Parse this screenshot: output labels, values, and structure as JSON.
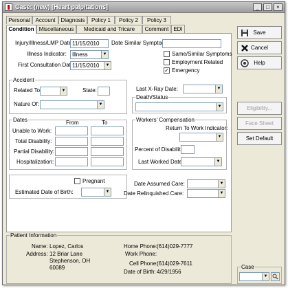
{
  "window": {
    "title": "Case: (new) [Heart palpitations]",
    "minimize": "_",
    "maximize": "□",
    "close": "×"
  },
  "tabs_top": [
    "Personal",
    "Account",
    "Diagnosis",
    "Policy 1",
    "Policy 2",
    "Policy 3"
  ],
  "tabs_bottom": [
    "Condition",
    "Miscellaneous",
    "Medicaid and Tricare",
    "Comment",
    "EDI"
  ],
  "condition": {
    "injury_label": "Injury/Illness/LMP Date:",
    "injury_value": "11/15/2010",
    "similar_symptoms_label": "Date Similar Symptoms:",
    "similar_symptoms_value": "",
    "illness_indicator_label": "Illness Indicator:",
    "illness_indicator_value": "Illness",
    "first_consult_label": "First Consultation Date:",
    "first_consult_value": "11/15/2010",
    "same_similar_label": "Same/Similar Symptoms",
    "employment_label": "Employment Related",
    "emergency_label": "Emergency",
    "same_similar_checked": false,
    "employment_checked": false,
    "emergency_checked": true
  },
  "accident": {
    "title": "Accident",
    "related_to_label": "Related To:",
    "state_label": "State:",
    "nature_of_label": "Nature Of:"
  },
  "xray": {
    "label": "Last X-Ray Date:",
    "death_status_title": "Death/Status"
  },
  "dates": {
    "title": "Dates",
    "from_label": "From",
    "to_label": "To",
    "rows": [
      "Unable to Work:",
      "Total Disability:",
      "Partial Disability:",
      "Hospitalization:"
    ]
  },
  "workers_comp": {
    "title": "Workers' Compensation",
    "return_label": "Return To Work Indicator:",
    "percent_label": "Percent of Disability:",
    "last_worked_label": "Last Worked Date:"
  },
  "pregnancy": {
    "pregnant_label": "Pregnant",
    "pregnant_checked": false,
    "edb_label": "Estimated Date of Birth:"
  },
  "care": {
    "assumed_label": "Date Assumed Care:",
    "relinquished_label": "Date Relinquished Care:"
  },
  "buttons": {
    "save": "Save",
    "cancel": "Cancel",
    "help": "Help",
    "eligibility": "Eligibility...",
    "face_sheet": "Face Sheet",
    "set_default": "Set Default"
  },
  "patient": {
    "title": "Patient Information",
    "name_label": "Name:",
    "name_value": "Lopez, Carlos",
    "address_label": "Address:",
    "address_line1": "12 Briar Lane",
    "address_line2": "Stephenson, OH",
    "address_line3": "60089",
    "home_phone_label": "Home Phone:",
    "home_phone_value": "(614)029-7777",
    "work_phone_label": "Work Phone:",
    "work_phone_value": "",
    "cell_phone_label": "Cell Phone:",
    "cell_phone_value": "(614)029-7611",
    "dob_label": "Date of Birth:",
    "dob_value": "4/29/1956"
  },
  "case_box": {
    "title": "Case"
  },
  "icons": {
    "dropdown": "▼",
    "check": "✓"
  }
}
